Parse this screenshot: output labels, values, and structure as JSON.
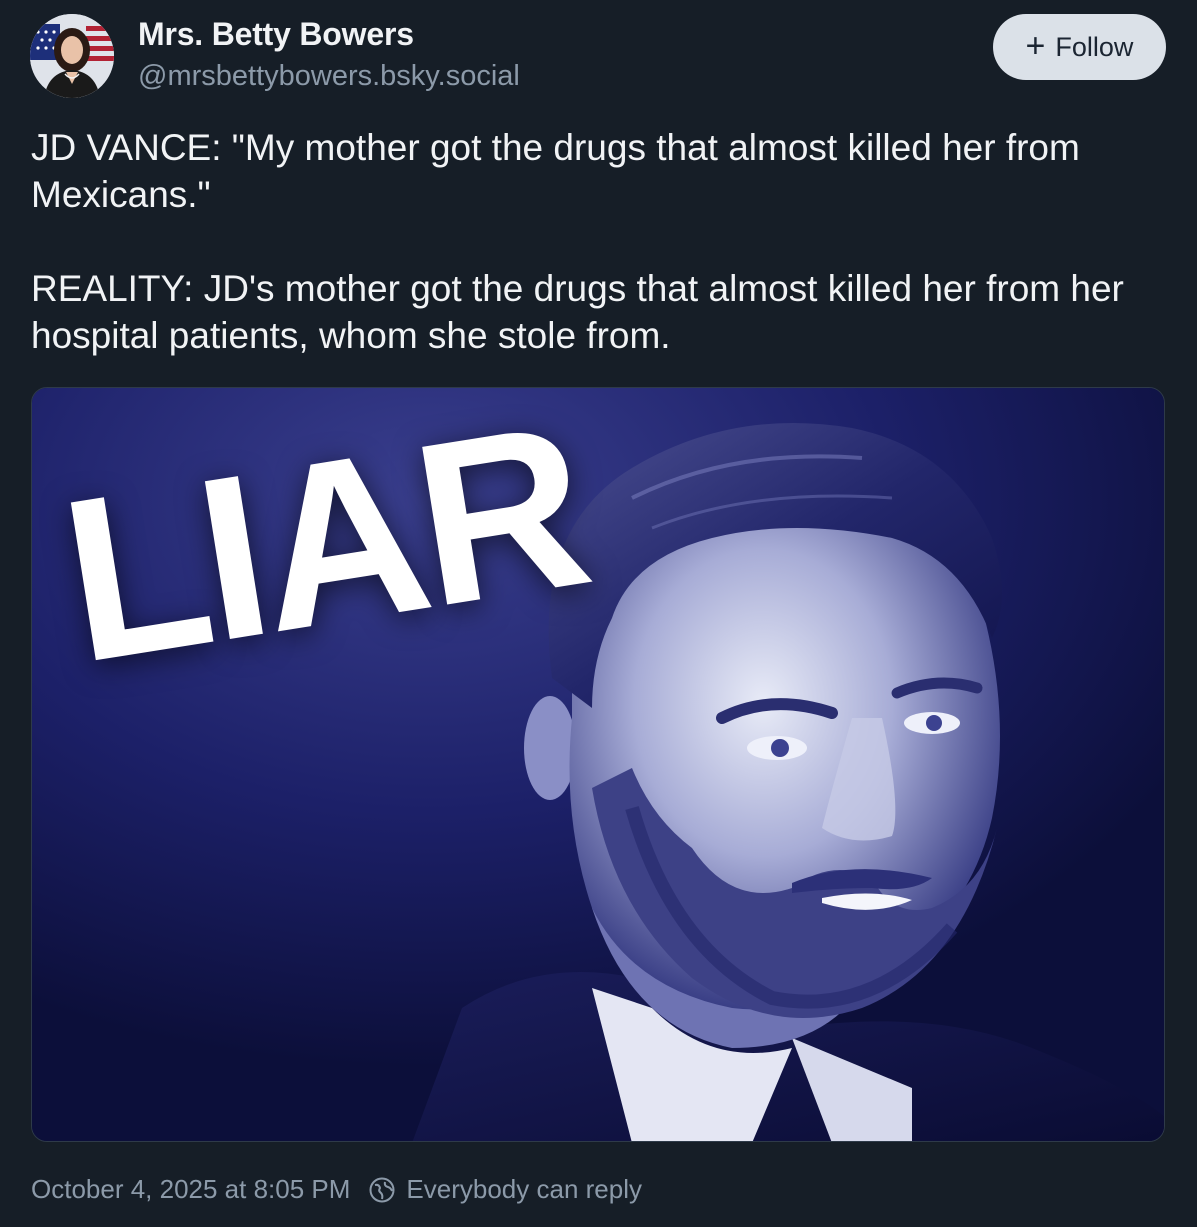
{
  "author": {
    "display_name": "Mrs. Betty Bowers",
    "handle": "@mrsbettybowers.bsky.social"
  },
  "follow_button": {
    "icon": "plus-icon",
    "label": "Follow"
  },
  "post": {
    "paragraphs": [
      "JD VANCE: \"My mother got the drugs that almost killed her from Mexicans.\"",
      "REALITY: JD's mother got the drugs that almost killed her from her hospital patients, whom she stole from."
    ],
    "image_overlay_text": "LIAR"
  },
  "footer": {
    "timestamp": "October 4, 2025 at 8:05 PM",
    "reply_icon": "globe-icon",
    "reply_setting": "Everybody can reply"
  },
  "colors": {
    "background": "#161e27",
    "text_primary": "#f1f3f5",
    "text_secondary": "#8c9aa9",
    "follow_bg": "#dbe1e8",
    "image_tint": "#1b1f6b"
  }
}
